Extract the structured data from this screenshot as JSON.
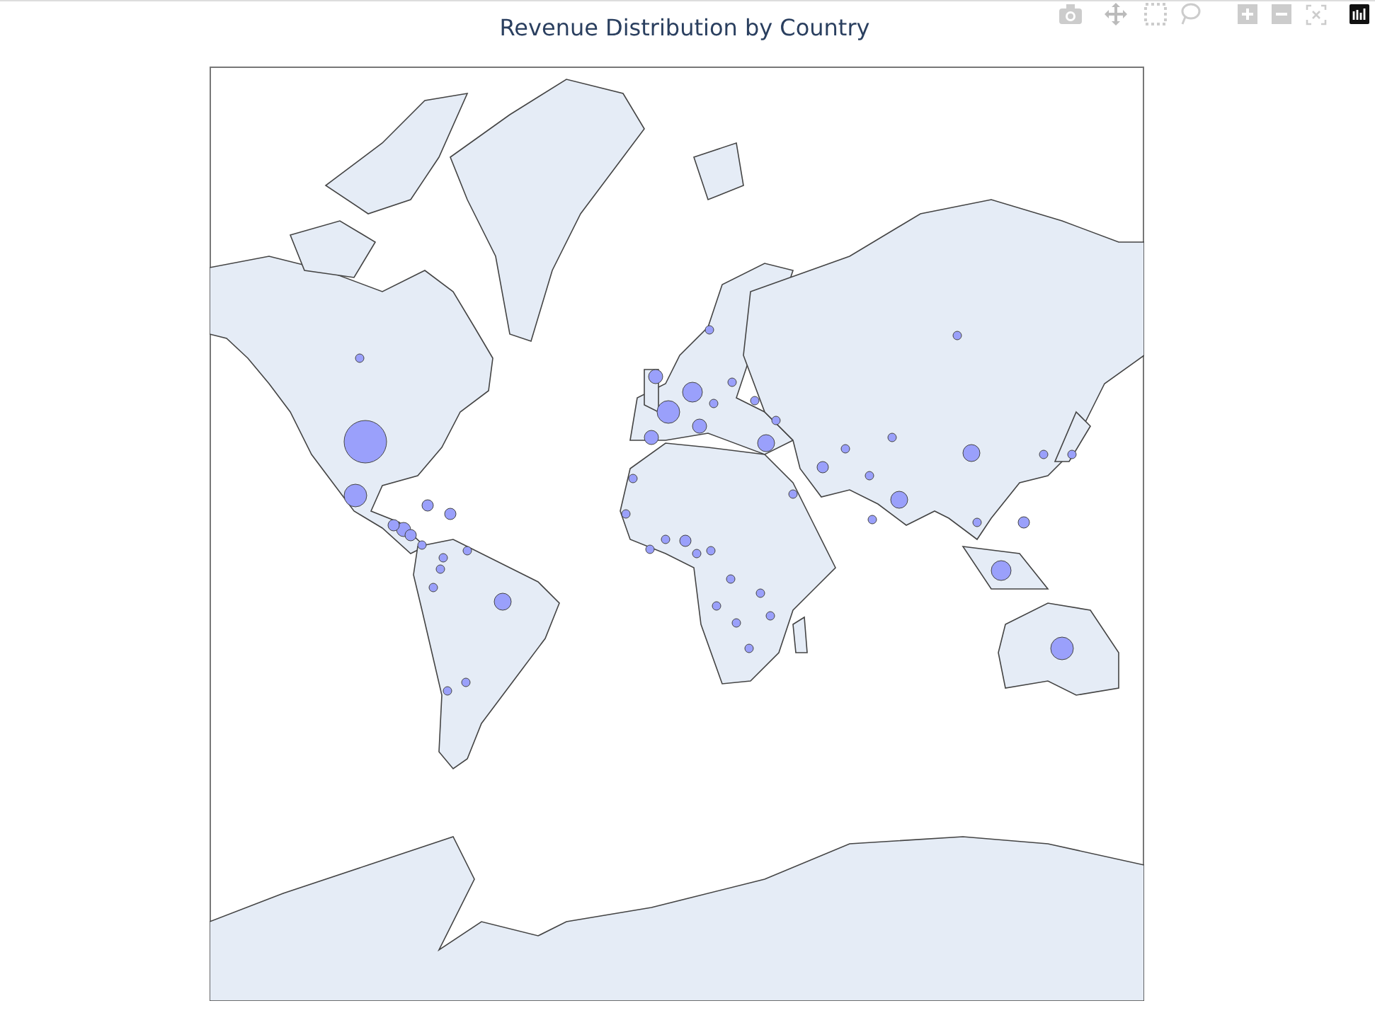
{
  "title": "Revenue Distribution by Country",
  "modebar": [
    {
      "kind": "camera"
    },
    {
      "kind": "pan"
    },
    {
      "kind": "box-select"
    },
    {
      "kind": "lasso"
    },
    {
      "kind": "zoom-in"
    },
    {
      "kind": "zoom-out"
    },
    {
      "kind": "reset"
    },
    {
      "kind": "logo"
    }
  ]
}
